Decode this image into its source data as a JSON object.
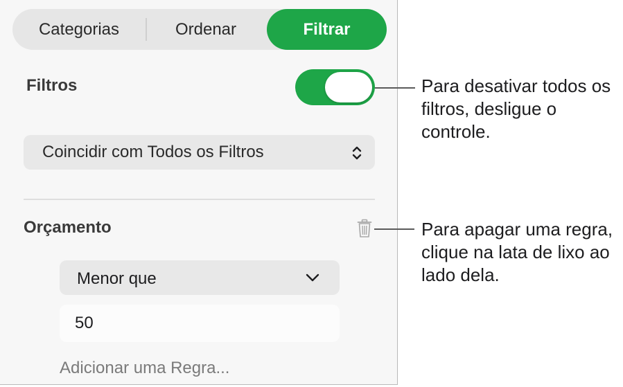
{
  "tabs": {
    "categories": "Categorias",
    "sort": "Ordenar",
    "filter": "Filtrar"
  },
  "filters": {
    "label": "Filtros",
    "toggle_on": true,
    "match_option": "Coincidir com Todos os Filtros"
  },
  "rule": {
    "title": "Orçamento",
    "condition": "Menor que",
    "value": "50",
    "add_rule_label": "Adicionar uma Regra..."
  },
  "callouts": {
    "toggle_note": "Para desativar todos os filtros, desligue o controle.",
    "trash_note": "Para apagar uma regra, clique na lata de lixo ao lado dela."
  },
  "icons": {
    "match_select": "updown-chevron-icon",
    "delete_rule": "trash-icon",
    "condition_select": "chevron-down-icon"
  },
  "colors": {
    "accent": "#1ea648",
    "panel_bg": "#f7f7f7",
    "control_bg": "#e8e8e8"
  }
}
